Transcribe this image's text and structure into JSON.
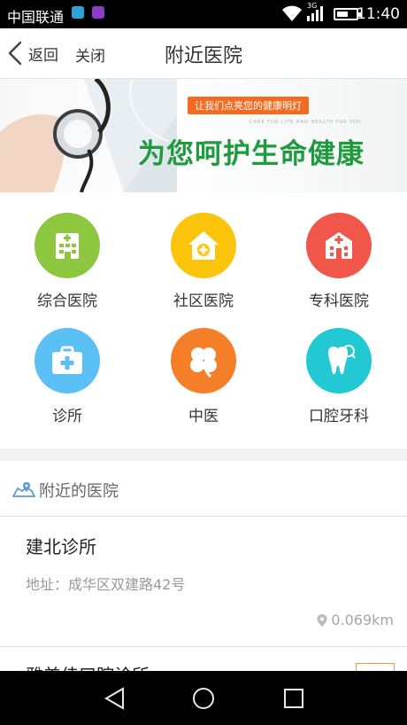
{
  "status_bar": {
    "carrier": "中国联通",
    "network": "3G",
    "time": "11:40"
  },
  "nav": {
    "back_label": "返回",
    "close_label": "关闭",
    "title": "附近医院"
  },
  "banner": {
    "tagline": "让我们点亮您的健康明灯",
    "subtitle": "CARE FOR LIFE AND HEALTH FOR YOU",
    "slogan": "为您呵护生命健康"
  },
  "categories": [
    {
      "label": "综合医院",
      "icon": "hospital-building-icon",
      "color": "#8dc63f"
    },
    {
      "label": "社区医院",
      "icon": "community-house-icon",
      "color": "#fdc40c"
    },
    {
      "label": "专科医院",
      "icon": "specialty-hospital-icon",
      "color": "#f0564a"
    },
    {
      "label": "诊所",
      "icon": "first-aid-kit-icon",
      "color": "#5bc0f5"
    },
    {
      "label": "中医",
      "icon": "clover-icon",
      "color": "#f57e29"
    },
    {
      "label": "口腔牙科",
      "icon": "tooth-icon",
      "color": "#22c9d3"
    }
  ],
  "nearby": {
    "section_title": "附近的医院",
    "hospitals": [
      {
        "name": "建北诊所",
        "address": "地址：成华区双建路42号",
        "distance": "0.069km"
      },
      {
        "name": "雅美佳口腔诊所"
      }
    ]
  }
}
